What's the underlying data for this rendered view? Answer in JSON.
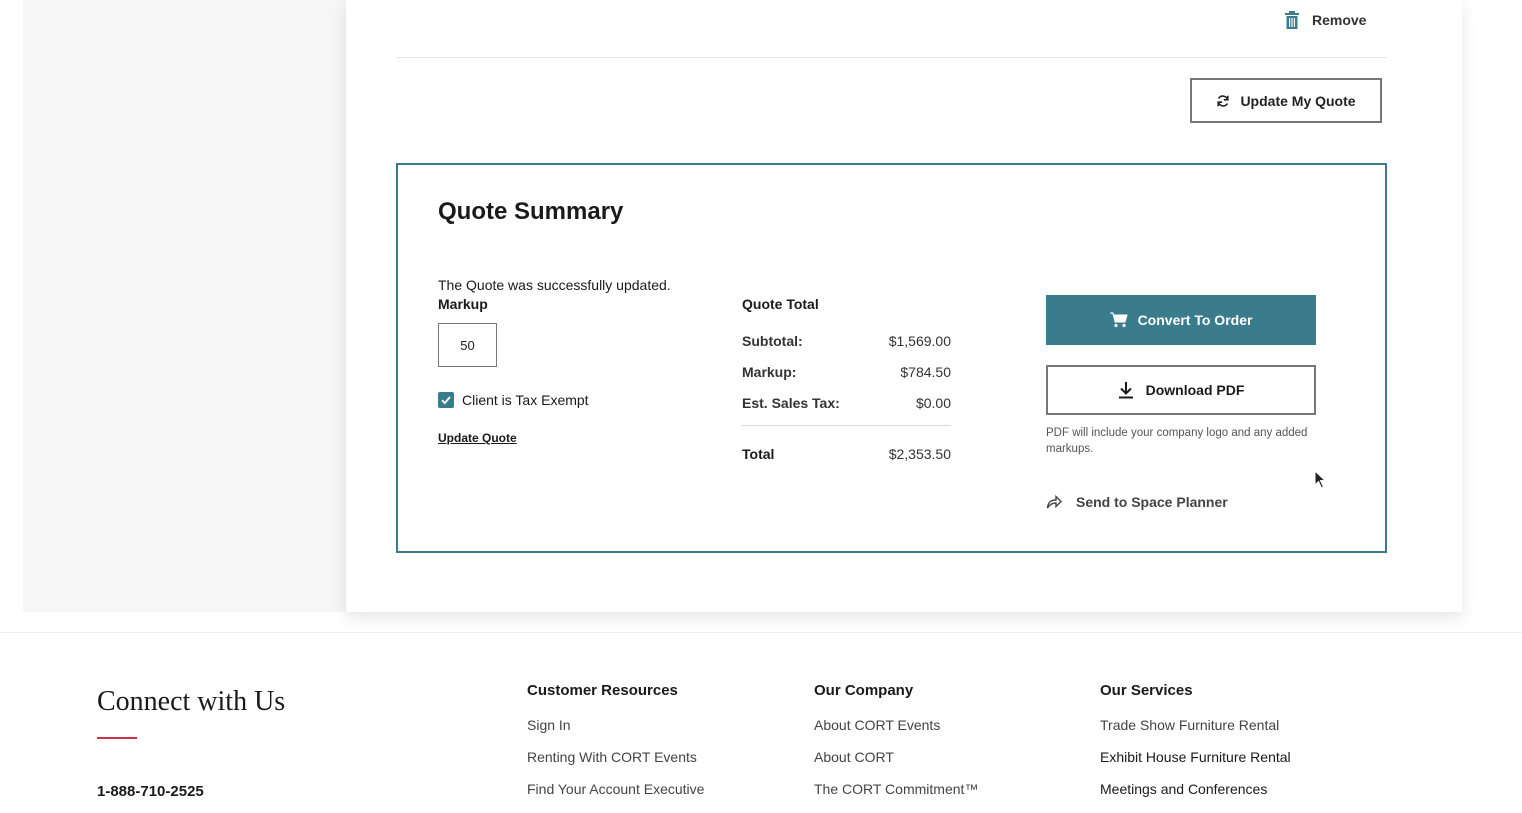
{
  "line_item": {
    "remove_label": "Remove"
  },
  "actions": {
    "update_my_quote_label": "Update My Quote"
  },
  "quote_summary": {
    "title": "Quote Summary",
    "success_message": "The Quote was successfully updated.",
    "markup_label": "Markup",
    "markup_value": "50",
    "tax_exempt_label": "Client is Tax Exempt",
    "tax_exempt_checked": true,
    "update_quote_link": "Update Quote",
    "totals": {
      "title": "Quote Total",
      "subtotal_label": "Subtotal:",
      "subtotal_value": "$1,569.00",
      "markup_label": "Markup:",
      "markup_value": "$784.50",
      "tax_label": "Est. Sales Tax:",
      "tax_value": "$0.00",
      "total_label": "Total",
      "total_value": "$2,353.50"
    },
    "convert_label": "Convert To Order",
    "download_label": "Download PDF",
    "pdf_note": "PDF will include your company logo and any added markups.",
    "space_planner_label": "Send to Space Planner"
  },
  "footer": {
    "connect_title": "Connect with Us",
    "phone": "1-888-710-2525",
    "columns": [
      {
        "heading": "Customer Resources",
        "links": [
          "Sign In",
          "Renting With CORT Events",
          "Find Your Account Executive"
        ]
      },
      {
        "heading": "Our Company",
        "links": [
          "About CORT Events",
          "About CORT",
          "The CORT Commitment™"
        ]
      },
      {
        "heading": "Our Services",
        "links": [
          "Trade Show Furniture Rental",
          "Exhibit House Furniture Rental",
          "Meetings and Conferences"
        ]
      }
    ]
  },
  "colors": {
    "accent_teal": "#3a7c8c",
    "footer_rule_red": "#c8344a",
    "left_rail_bg": "#f6f6f7"
  }
}
